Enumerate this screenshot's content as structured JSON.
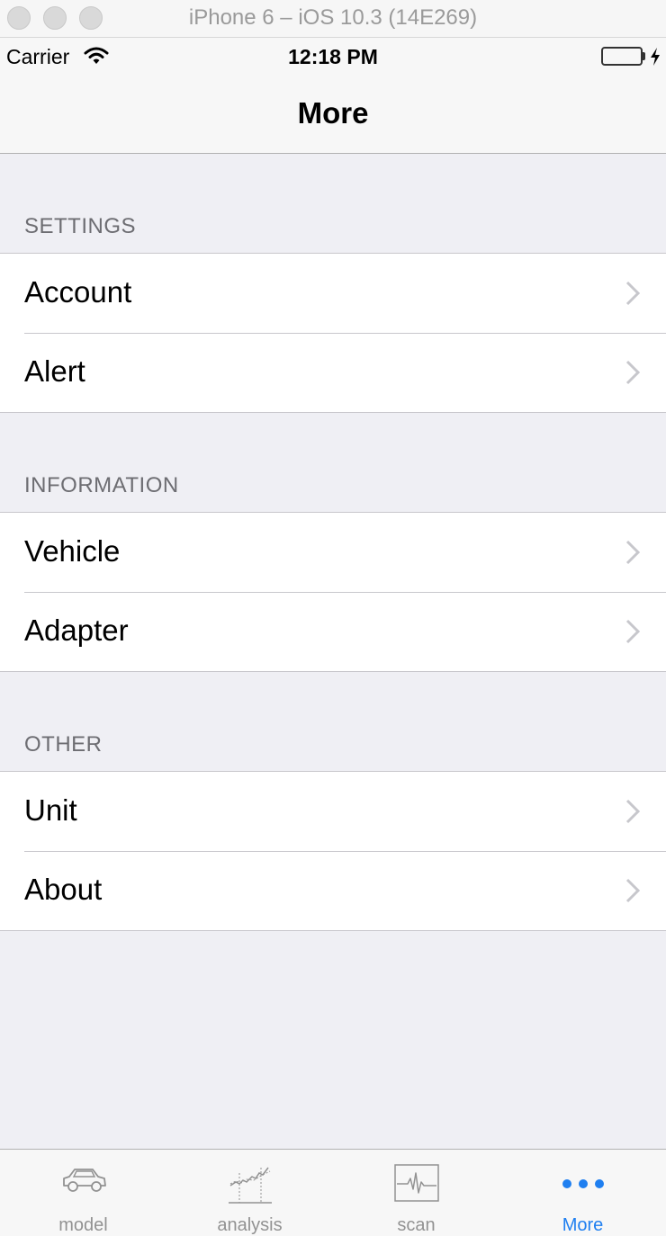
{
  "simulator": {
    "title": "iPhone 6 – iOS 10.3 (14E269)"
  },
  "status_bar": {
    "carrier": "Carrier",
    "time": "12:18 PM"
  },
  "nav": {
    "title": "More"
  },
  "sections": [
    {
      "header": "SETTINGS",
      "rows": [
        {
          "label": "Account"
        },
        {
          "label": "Alert"
        }
      ]
    },
    {
      "header": "INFORMATION",
      "rows": [
        {
          "label": "Vehicle"
        },
        {
          "label": "Adapter"
        }
      ]
    },
    {
      "header": "OTHER",
      "rows": [
        {
          "label": "Unit"
        },
        {
          "label": "About"
        }
      ]
    }
  ],
  "tabs": [
    {
      "label": "model",
      "icon": "car-icon"
    },
    {
      "label": "analysis",
      "icon": "analysis-chart-icon"
    },
    {
      "label": "scan",
      "icon": "scan-waveform-icon"
    },
    {
      "label": "More",
      "icon": "more-dots-icon",
      "active": true
    }
  ],
  "colors": {
    "accent": "#1f7ff0",
    "battery": "#4cd964",
    "inactive_tab": "#929292",
    "group_background": "#efeff4"
  }
}
